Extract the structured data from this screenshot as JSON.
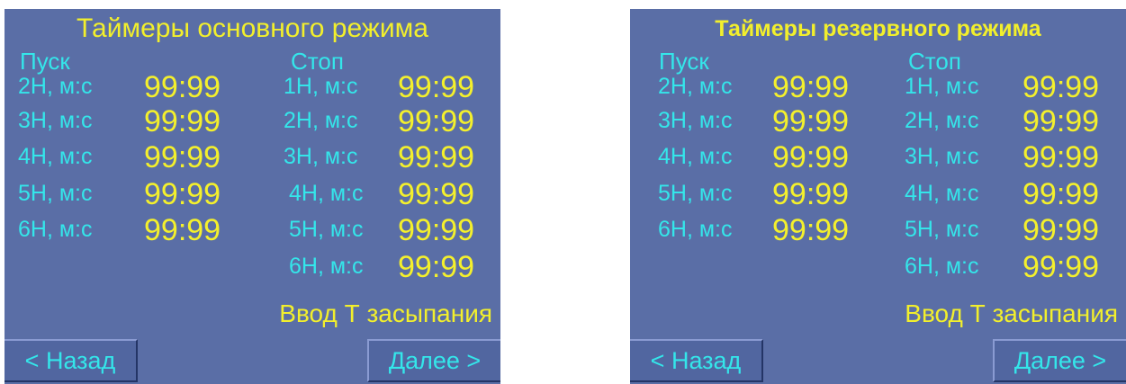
{
  "panels": [
    {
      "title": "Таймеры основного режима",
      "start_header": "Пуск",
      "stop_header": "Стоп",
      "start_rows": [
        {
          "label": "2Н, м:с",
          "value": "99:99"
        },
        {
          "label": "3Н, м:с",
          "value": "99:99"
        },
        {
          "label": "4Н, м:с",
          "value": "99:99"
        },
        {
          "label": "5Н, м:с",
          "value": "99:99"
        },
        {
          "label": "6Н, м:с",
          "value": "99:99"
        }
      ],
      "stop_rows": [
        {
          "label": "1Н, м:с",
          "value": "99:99"
        },
        {
          "label": "2Н, м:с",
          "value": "99:99"
        },
        {
          "label": "3Н, м:с",
          "value": "99:99"
        },
        {
          "label": "4Н, м:с",
          "value": "99:99"
        },
        {
          "label": "5Н, м:с",
          "value": "99:99"
        },
        {
          "label": "6Н, м:с",
          "value": "99:99"
        }
      ],
      "sleep_link": "Ввод Т засыпания",
      "back_button": "< Назад",
      "next_button": "Далее >"
    },
    {
      "title": "Таймеры резервного режима",
      "start_header": "Пуск",
      "stop_header": "Стоп",
      "start_rows": [
        {
          "label": "2Н, м:с",
          "value": "99:99"
        },
        {
          "label": "3Н, м:с",
          "value": "99:99"
        },
        {
          "label": "4Н, м:с",
          "value": "99:99"
        },
        {
          "label": "5Н, м:с",
          "value": "99:99"
        },
        {
          "label": "6Н, м:с",
          "value": "99:99"
        }
      ],
      "stop_rows": [
        {
          "label": "1Н, м:с",
          "value": "99:99"
        },
        {
          "label": "2Н, м:с",
          "value": "99:99"
        },
        {
          "label": "3Н, м:с",
          "value": "99:99"
        },
        {
          "label": "4Н, м:с",
          "value": "99:99"
        },
        {
          "label": "5Н, м:с",
          "value": "99:99"
        },
        {
          "label": "6Н, м:с",
          "value": "99:99"
        }
      ],
      "sleep_link": "Ввод Т засыпания",
      "back_button": "< Назад",
      "next_button": "Далее >"
    }
  ],
  "colors": {
    "panel_background": "#5a6ea6",
    "label_cyan": "#34e6ea",
    "value_yellow": "#f4f02c"
  }
}
